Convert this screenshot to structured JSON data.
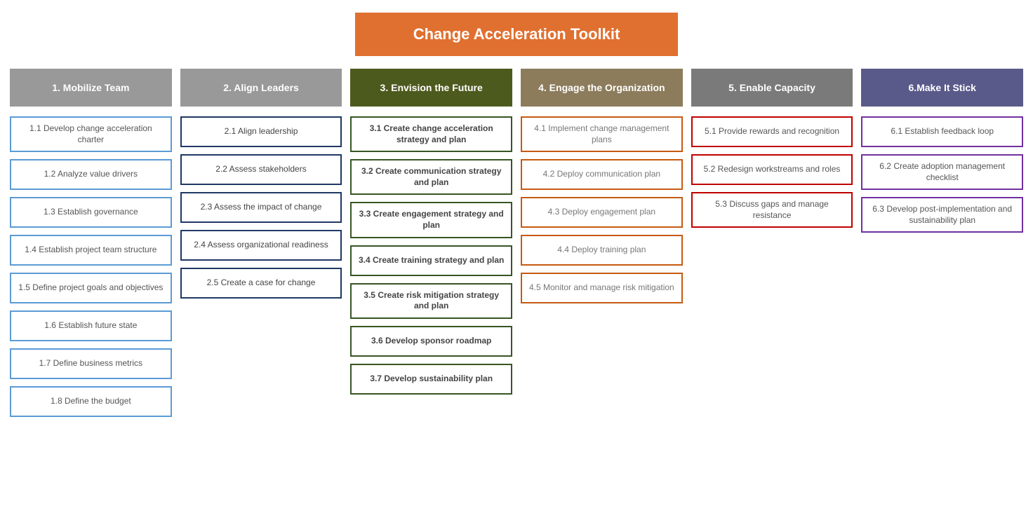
{
  "title": "Change Acceleration Toolkit",
  "columns": [
    {
      "id": "mobilize",
      "header": "1. Mobilize Team",
      "headerClass": "gray",
      "cards": [
        {
          "label": "1.1 Develop change acceleration charter",
          "style": "blue"
        },
        {
          "label": "1.2 Analyze value drivers",
          "style": "blue"
        },
        {
          "label": "1.3 Establish governance",
          "style": "blue"
        },
        {
          "label": "1.4 Establish project team structure",
          "style": "blue"
        },
        {
          "label": "1.5 Define project goals and objectives",
          "style": "blue"
        },
        {
          "label": "1.6 Establish future state",
          "style": "blue"
        },
        {
          "label": "1.7 Define business metrics",
          "style": "blue"
        },
        {
          "label": "1.8 Define the budget",
          "style": "blue"
        }
      ]
    },
    {
      "id": "align",
      "header": "2. Align Leaders",
      "headerClass": "gray",
      "cards": [
        {
          "label": "2.1 Align leadership",
          "style": "dark-blue"
        },
        {
          "label": "2.2 Assess stakeholders",
          "style": "dark-blue"
        },
        {
          "label": "2.3 Assess the impact of change",
          "style": "dark-blue"
        },
        {
          "label": "2.4 Assess organizational readiness",
          "style": "dark-blue"
        },
        {
          "label": "2.5 Create a case for change",
          "style": "dark-blue"
        }
      ]
    },
    {
      "id": "envision",
      "header": "3. Envision the Future",
      "headerClass": "dark-olive",
      "cards": [
        {
          "label": "3.1 Create change acceleration strategy and plan",
          "style": "dark-green"
        },
        {
          "label": "3.2 Create communication strategy and plan",
          "style": "dark-green"
        },
        {
          "label": "3.3 Create engagement strategy and plan",
          "style": "dark-green"
        },
        {
          "label": "3.4 Create training strategy and plan",
          "style": "dark-green"
        },
        {
          "label": "3.5 Create risk mitigation strategy and plan",
          "style": "dark-green"
        },
        {
          "label": "3.6 Develop sponsor roadmap",
          "style": "dark-green"
        },
        {
          "label": "3.7 Develop sustainability plan",
          "style": "dark-green"
        }
      ]
    },
    {
      "id": "engage",
      "header": "4. Engage the Organization",
      "headerClass": "brown-gray",
      "cards": [
        {
          "label": "4.1 Implement change management plans",
          "style": "brown-orange"
        },
        {
          "label": "4.2 Deploy communication plan",
          "style": "brown-orange"
        },
        {
          "label": "4.3 Deploy engagement plan",
          "style": "brown-orange"
        },
        {
          "label": "4.4 Deploy training plan",
          "style": "brown-orange"
        },
        {
          "label": "4.5 Monitor and manage risk mitigation",
          "style": "brown-orange"
        }
      ]
    },
    {
      "id": "enable",
      "header": "5. Enable Capacity",
      "headerClass": "dark-gray",
      "cards": [
        {
          "label": "5.1 Provide rewards and recognition",
          "style": "red"
        },
        {
          "label": "5.2 Redesign workstreams and roles",
          "style": "red"
        },
        {
          "label": "5.3 Discuss gaps and manage resistance",
          "style": "red"
        }
      ]
    },
    {
      "id": "stick",
      "header": "6.Make It Stick",
      "headerClass": "dark-purple",
      "cards": [
        {
          "label": "6.1 Establish feedback loop",
          "style": "purple"
        },
        {
          "label": "6.2 Create adoption management checklist",
          "style": "purple"
        },
        {
          "label": "6.3 Develop post-implementation and sustainability plan",
          "style": "purple"
        }
      ]
    }
  ]
}
